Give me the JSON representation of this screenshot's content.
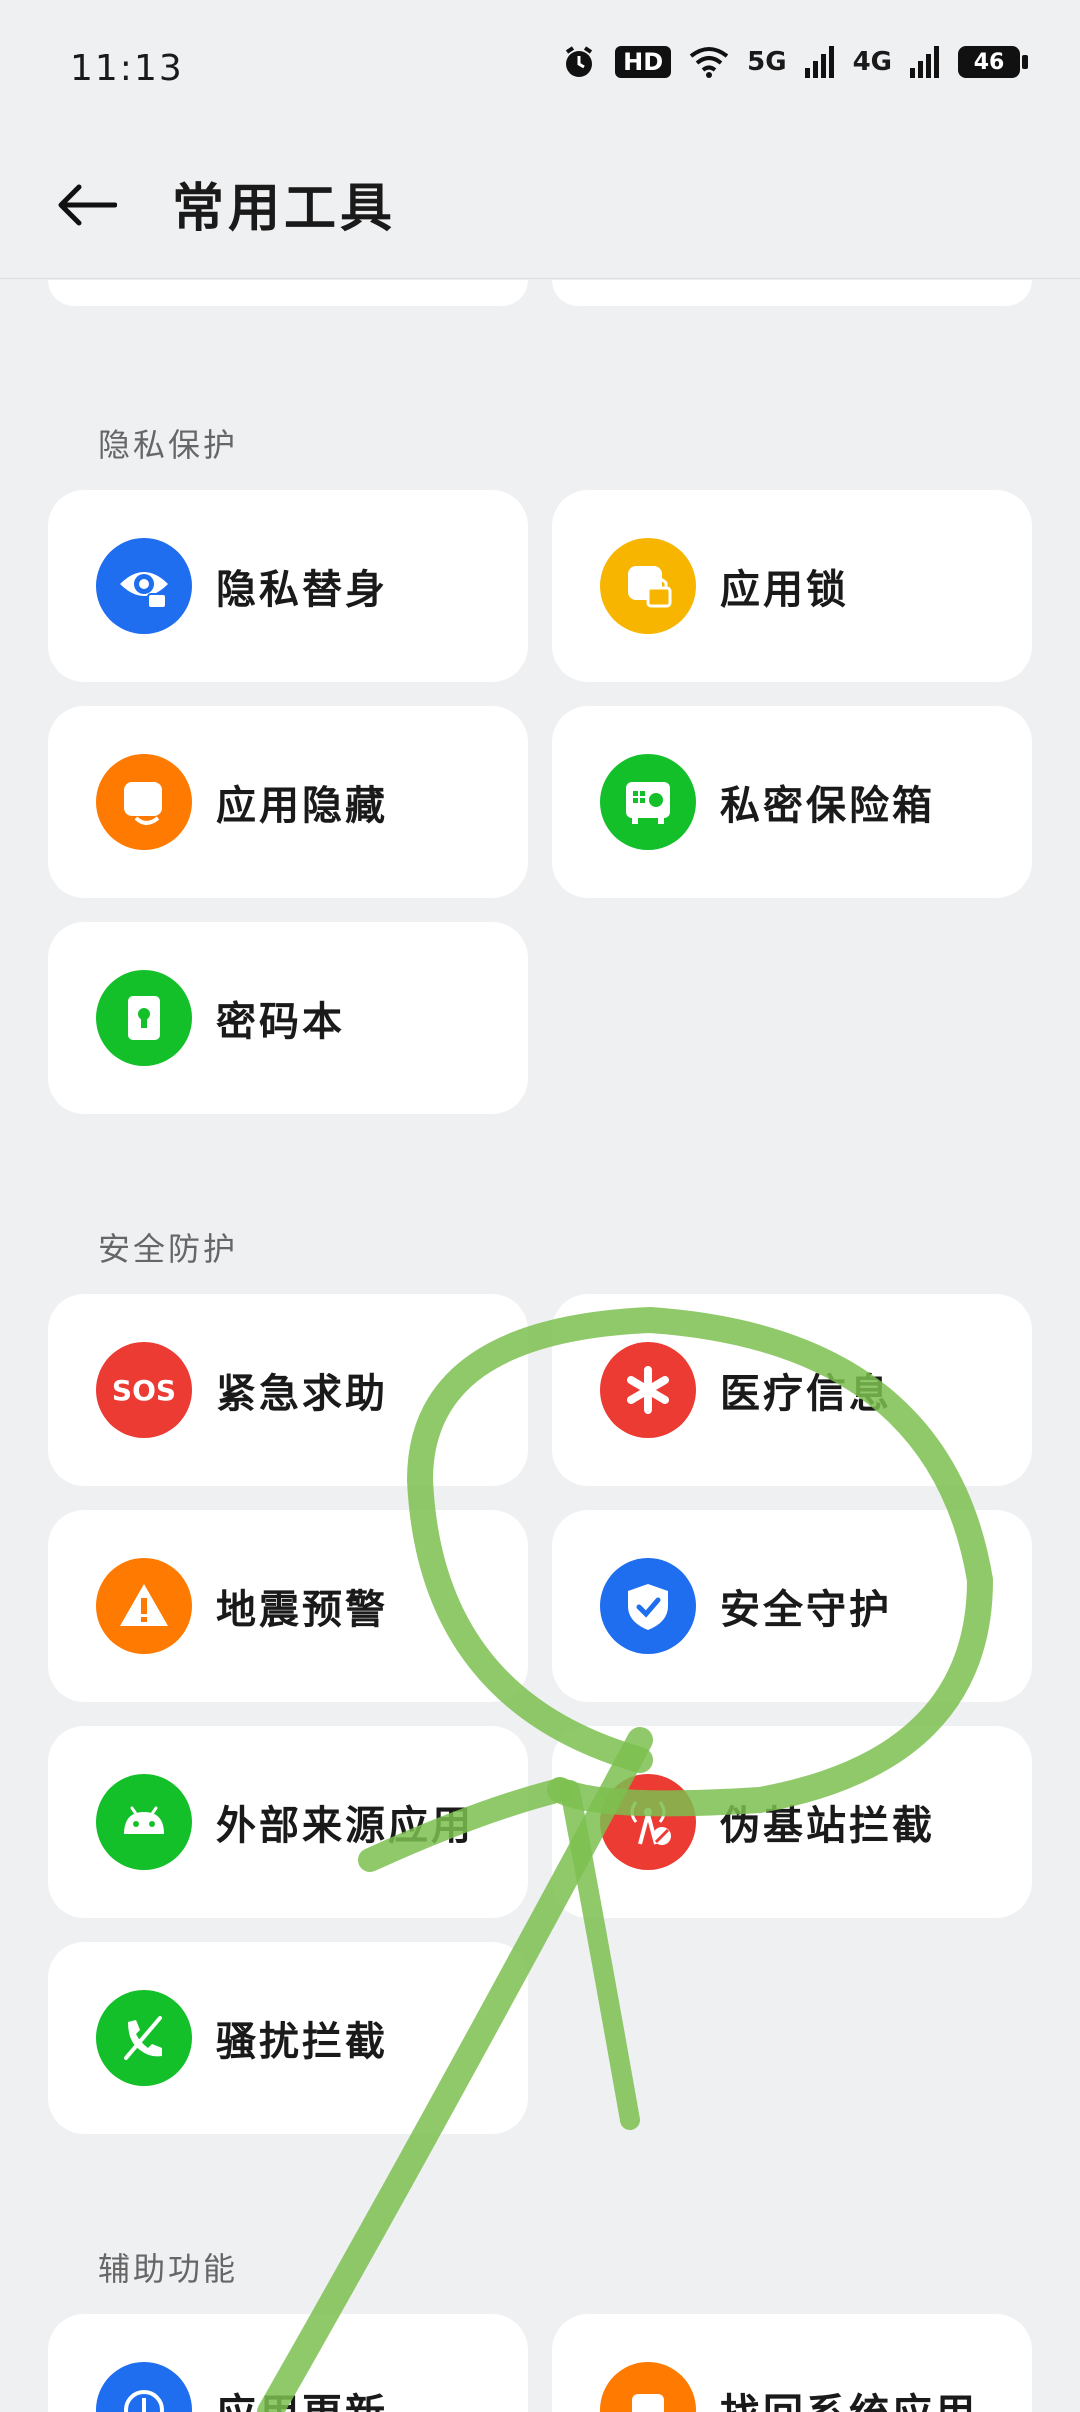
{
  "status": {
    "time": "11:13",
    "hd": "HD",
    "signal1": "5G",
    "signal2": "4G",
    "battery": "46"
  },
  "appbar": {
    "title": "常用工具"
  },
  "sections": {
    "privacy": {
      "title": "隐私保护",
      "items": [
        "隐私替身",
        "应用锁",
        "应用隐藏",
        "私密保险箱",
        "密码本"
      ]
    },
    "security": {
      "title": "安全防护",
      "items": [
        "紧急求助",
        "医疗信息",
        "地震预警",
        "安全守护",
        "外部来源应用",
        "伪基站拦截",
        "骚扰拦截"
      ]
    },
    "accessibility": {
      "title": "辅助功能",
      "items": [
        "应用更新",
        "找回系统应用"
      ]
    }
  },
  "colors": {
    "blue": "#1f6ef0",
    "yellow": "#f7b500",
    "orange": "#ff7a00",
    "green": "#14c02a",
    "red": "#ec3b33",
    "annotation": "#7dc04f"
  },
  "icons": {
    "privacy_clone": "eye-lock-icon",
    "app_lock": "lock-icon",
    "app_hide": "hide-app-icon",
    "private_safe": "safe-icon",
    "password_book": "keyhole-book-icon",
    "sos": "sos-icon",
    "medical": "asterisk-icon",
    "earthquake": "warning-icon",
    "guard": "shield-check-icon",
    "external_apps": "android-icon",
    "fake_station": "antenna-icon",
    "harass": "phone-block-icon",
    "app_update": "update-icon",
    "recover_apps": "restore-icon"
  },
  "sos_text": "SOS"
}
